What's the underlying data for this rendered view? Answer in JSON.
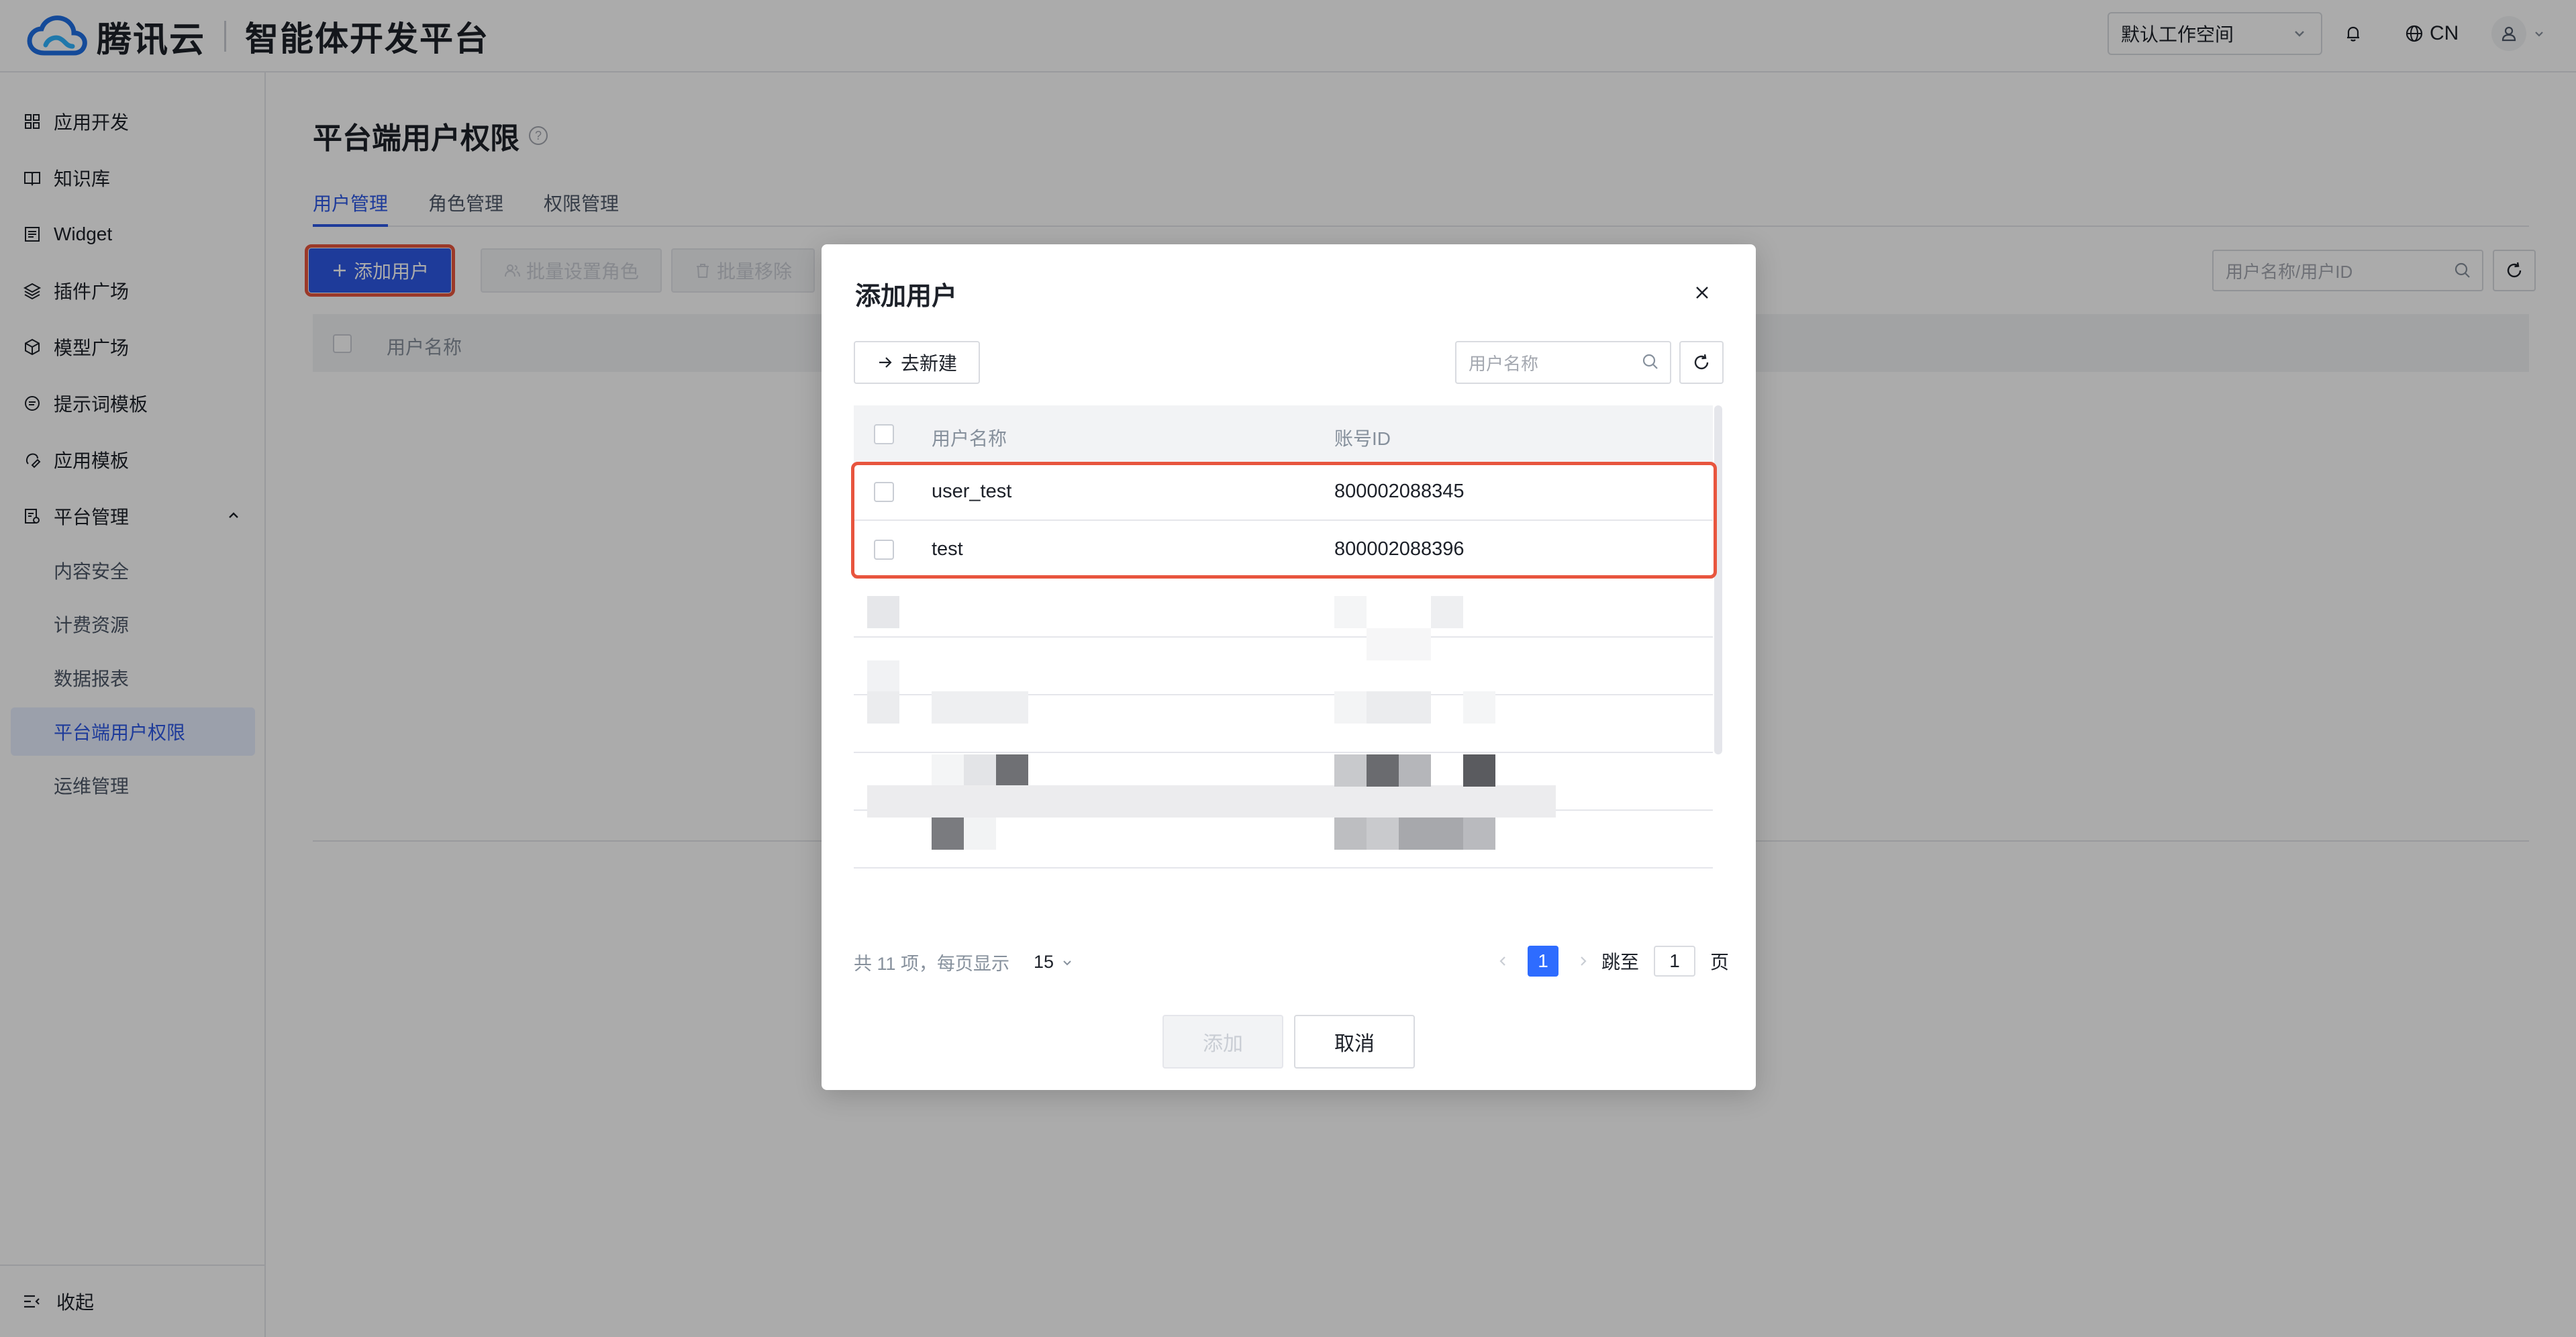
{
  "header": {
    "brand": "腾讯云",
    "product": "智能体开发平台",
    "workspace": "默认工作空间",
    "language": "CN"
  },
  "sidebar": {
    "items": [
      {
        "label": "应用开发",
        "icon": "grid-icon"
      },
      {
        "label": "知识库",
        "icon": "book-icon"
      },
      {
        "label": "Widget",
        "icon": "widget-icon"
      },
      {
        "label": "插件广场",
        "icon": "layers-icon"
      },
      {
        "label": "模型广场",
        "icon": "cube-icon"
      },
      {
        "label": "提示词模板",
        "icon": "prompt-icon"
      },
      {
        "label": "应用模板",
        "icon": "template-icon"
      },
      {
        "label": "平台管理",
        "icon": "manage-icon"
      }
    ],
    "sub_items": [
      {
        "label": "内容安全"
      },
      {
        "label": "计费资源"
      },
      {
        "label": "数据报表"
      },
      {
        "label": "平台端用户权限",
        "active": true
      },
      {
        "label": "运维管理"
      }
    ],
    "collapse_label": "收起"
  },
  "page": {
    "title": "平台端用户权限",
    "tabs": [
      "用户管理",
      "角色管理",
      "权限管理"
    ],
    "active_tab": "用户管理",
    "add_user": "添加用户",
    "batch_role": "批量设置角色",
    "batch_remove": "批量移除",
    "search_placeholder": "用户名称/用户ID",
    "col_username": "用户名称"
  },
  "modal": {
    "title": "添加用户",
    "new_button": "去新建",
    "search_placeholder": "用户名称",
    "columns": {
      "username": "用户名称",
      "account_id": "账号ID"
    },
    "rows": [
      {
        "username": "user_test",
        "account_id": "800002088345"
      },
      {
        "username": "test",
        "account_id": "800002088396"
      }
    ],
    "footer": {
      "total_text": "共 11 项，每页显示",
      "page_size": "15",
      "current_page": "1",
      "jump_label": "跳至",
      "jump_value": "1",
      "page_suffix": "页"
    },
    "add_button": "添加",
    "cancel_button": "取消"
  },
  "colors": {
    "primary": "#2e59e6",
    "highlight": "#e8553e",
    "pager_active": "#2e6cff"
  }
}
